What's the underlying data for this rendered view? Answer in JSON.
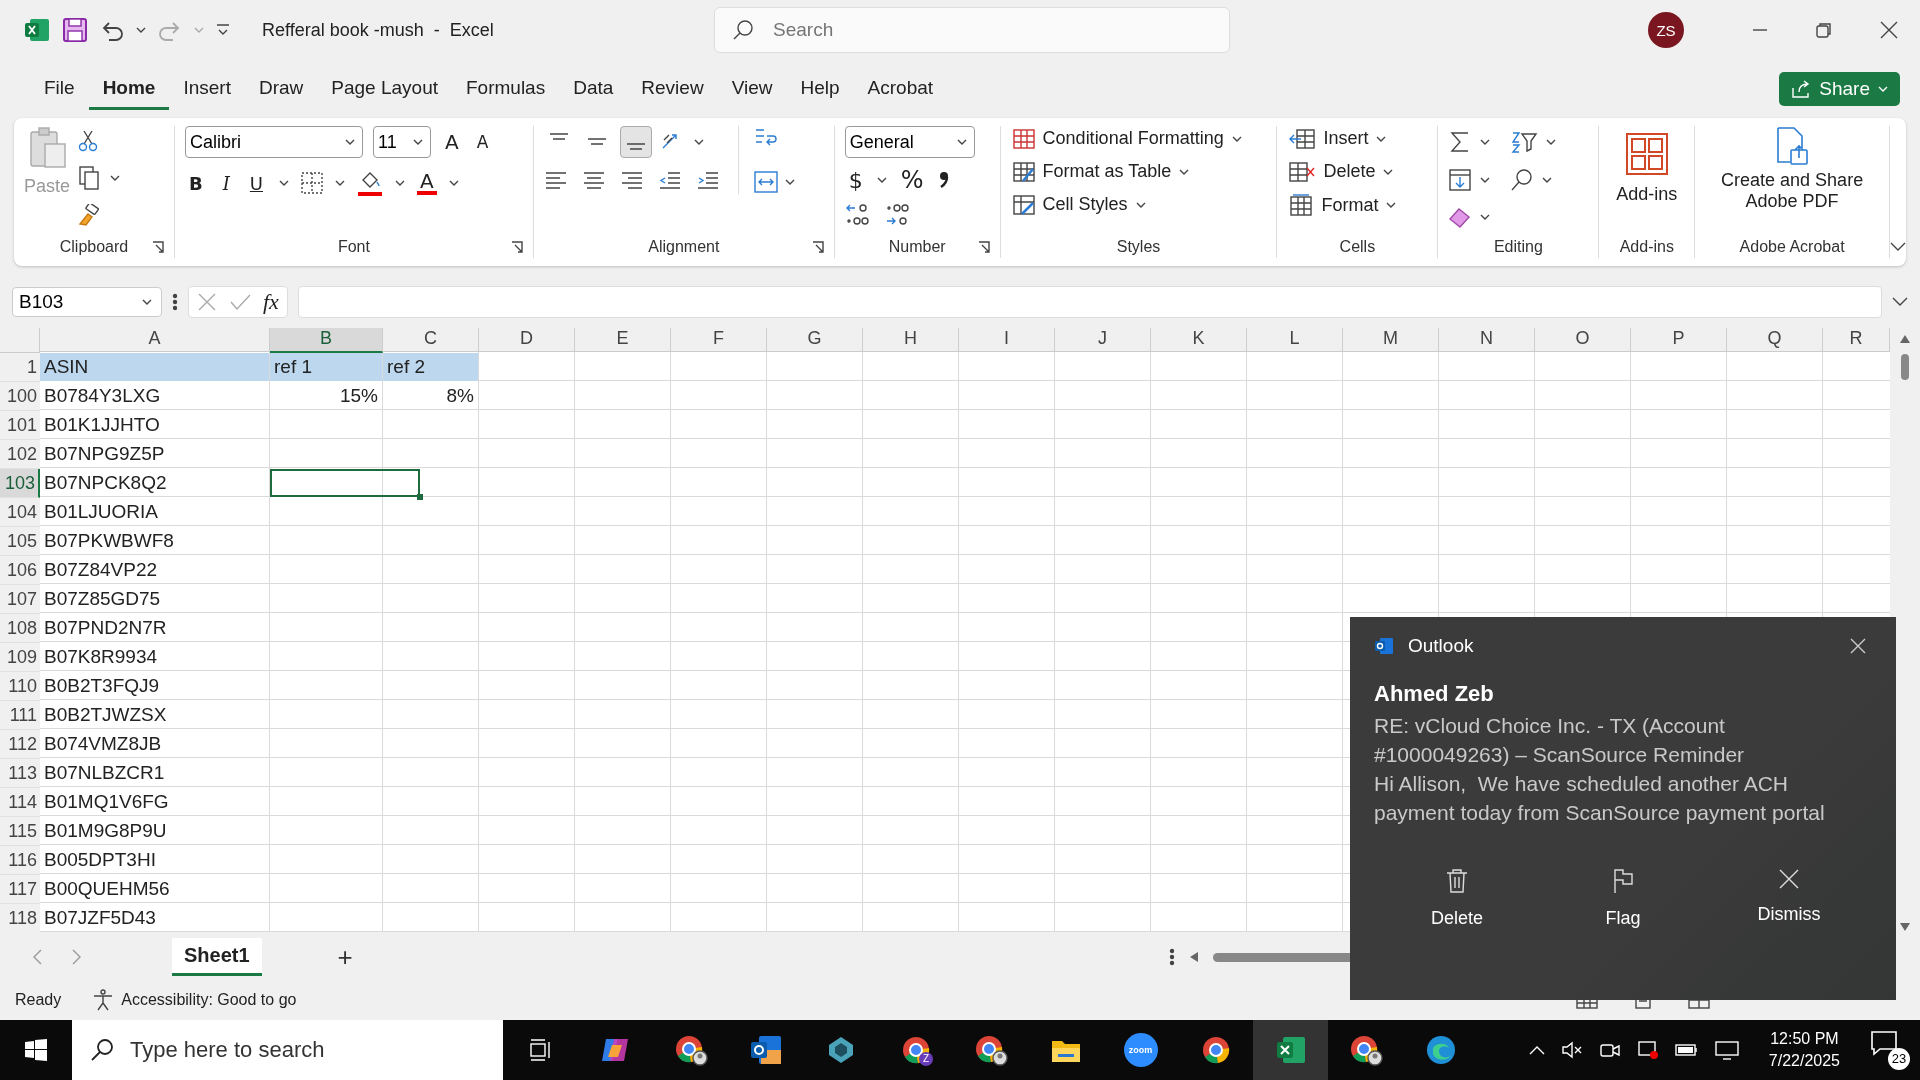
{
  "title_bar": {
    "document_title": "Refferal book -mush  -  Excel",
    "search_placeholder": "Search",
    "avatar_initials": "ZS"
  },
  "menu_tabs": [
    {
      "label": "File",
      "selected": false
    },
    {
      "label": "Home",
      "selected": true
    },
    {
      "label": "Insert",
      "selected": false
    },
    {
      "label": "Draw",
      "selected": false
    },
    {
      "label": "Page Layout",
      "selected": false
    },
    {
      "label": "Formulas",
      "selected": false
    },
    {
      "label": "Data",
      "selected": false
    },
    {
      "label": "Review",
      "selected": false
    },
    {
      "label": "View",
      "selected": false
    },
    {
      "label": "Help",
      "selected": false
    },
    {
      "label": "Acrobat",
      "selected": false
    }
  ],
  "share_button": "Share",
  "ribbon": {
    "clipboard": {
      "paste": "Paste",
      "label": "Clipboard"
    },
    "font": {
      "font_name": "Calibri",
      "font_size": "11",
      "grow": "A",
      "shrink": "A",
      "bold": "B",
      "italic": "I",
      "underline": "U",
      "font_color": "A",
      "label": "Font"
    },
    "alignment": {
      "vertical_align": [
        {
          "selected": false
        },
        {
          "selected": false
        },
        {
          "selected": true
        }
      ],
      "label": "Alignment"
    },
    "number": {
      "format": "General",
      "currency": "$",
      "percent": "%",
      "label": "Number"
    },
    "styles": {
      "items": [
        {
          "label": "Conditional Formatting",
          "kind": "conditional"
        },
        {
          "label": "Format as Table",
          "kind": "table"
        },
        {
          "label": "Cell Styles",
          "kind": "cellstyle"
        }
      ],
      "label": "Styles"
    },
    "cells": {
      "items": [
        {
          "label": "Insert",
          "kind": "insert"
        },
        {
          "label": "Delete",
          "kind": "delete"
        },
        {
          "label": "Format",
          "kind": "format"
        }
      ],
      "label": "Cells"
    },
    "editing": {
      "label": "Editing"
    },
    "addins": {
      "button": "Add-ins",
      "label": "Add-ins"
    },
    "acrobat": {
      "button": "Create and Share Adobe PDF",
      "label": "Adobe Acrobat"
    }
  },
  "formula_bar": {
    "name_box": "B103",
    "fx": "fx"
  },
  "sheet": {
    "columns": [
      {
        "letter": "A",
        "selected": false
      },
      {
        "letter": "B",
        "selected": true
      },
      {
        "letter": "C",
        "selected": false
      },
      {
        "letter": "D",
        "selected": false
      },
      {
        "letter": "E",
        "selected": false
      },
      {
        "letter": "F",
        "selected": false
      },
      {
        "letter": "G",
        "selected": false
      },
      {
        "letter": "H",
        "selected": false
      },
      {
        "letter": "I",
        "selected": false
      },
      {
        "letter": "J",
        "selected": false
      },
      {
        "letter": "K",
        "selected": false
      },
      {
        "letter": "L",
        "selected": false
      },
      {
        "letter": "M",
        "selected": false
      },
      {
        "letter": "N",
        "selected": false
      },
      {
        "letter": "O",
        "selected": false
      },
      {
        "letter": "P",
        "selected": false
      },
      {
        "letter": "Q",
        "selected": false
      },
      {
        "letter": "R",
        "selected": false
      }
    ],
    "rows": [
      {
        "number": "1",
        "kind": "header",
        "selected": false,
        "cells": [
          {
            "text": "ASIN"
          },
          {
            "text": "ref 1"
          },
          {
            "text": "ref 2"
          }
        ]
      },
      {
        "number": "100",
        "kind": "data",
        "selected": false,
        "cells": [
          {
            "text": "B0784Y3LXG"
          },
          {
            "text": "15%",
            "kind": "number"
          },
          {
            "text": "8%",
            "kind": "number"
          }
        ]
      },
      {
        "number": "101",
        "kind": "data",
        "selected": false,
        "cells": [
          {
            "text": "B01K1JJHTO"
          }
        ]
      },
      {
        "number": "102",
        "kind": "data",
        "selected": false,
        "cells": [
          {
            "text": "B07NPG9Z5P"
          }
        ]
      },
      {
        "number": "103",
        "kind": "data",
        "selected": true,
        "cells": [
          {
            "text": "B07NPCK8Q2"
          }
        ]
      },
      {
        "number": "104",
        "kind": "data",
        "selected": false,
        "cells": [
          {
            "text": "B01LJUORIA"
          }
        ]
      },
      {
        "number": "105",
        "kind": "data",
        "selected": false,
        "cells": [
          {
            "text": "B07PKWBWF8"
          }
        ]
      },
      {
        "number": "106",
        "kind": "data",
        "selected": false,
        "cells": [
          {
            "text": "B07Z84VP22"
          }
        ]
      },
      {
        "number": "107",
        "kind": "data",
        "selected": false,
        "cells": [
          {
            "text": "B07Z85GD75"
          }
        ]
      },
      {
        "number": "108",
        "kind": "data",
        "selected": false,
        "cells": [
          {
            "text": "B07PND2N7R"
          }
        ]
      },
      {
        "number": "109",
        "kind": "data",
        "selected": false,
        "cells": [
          {
            "text": "B07K8R9934"
          }
        ]
      },
      {
        "number": "110",
        "kind": "data",
        "selected": false,
        "cells": [
          {
            "text": "B0B2T3FQJ9"
          }
        ]
      },
      {
        "number": "111",
        "kind": "data",
        "selected": false,
        "cells": [
          {
            "text": "B0B2TJWZSX"
          }
        ]
      },
      {
        "number": "112",
        "kind": "data",
        "selected": false,
        "cells": [
          {
            "text": "B074VMZ8JB"
          }
        ]
      },
      {
        "number": "113",
        "kind": "data",
        "selected": false,
        "cells": [
          {
            "text": "B07NLBZCR1"
          }
        ]
      },
      {
        "number": "114",
        "kind": "data",
        "selected": false,
        "cells": [
          {
            "text": "B01MQ1V6FG"
          }
        ]
      },
      {
        "number": "115",
        "kind": "data",
        "selected": false,
        "cells": [
          {
            "text": "B01M9G8P9U"
          }
        ]
      },
      {
        "number": "116",
        "kind": "data",
        "selected": false,
        "cells": [
          {
            "text": "B005DPT3HI"
          }
        ]
      },
      {
        "number": "117",
        "kind": "data",
        "selected": false,
        "cells": [
          {
            "text": "B00QUEHM56"
          }
        ]
      },
      {
        "number": "118",
        "kind": "data",
        "selected": false,
        "cells": [
          {
            "text": "B07JZF5D43"
          }
        ]
      }
    ]
  },
  "sheet_tabs": {
    "tabs": [
      {
        "label": "Sheet1",
        "selected": true
      }
    ],
    "add": "+"
  },
  "status_bar": {
    "ready": "Ready",
    "accessibility": "Accessibility: Good to go"
  },
  "notification": {
    "app": "Outlook",
    "sender": "Ahmed Zeb",
    "subject": "RE: vCloud Choice Inc. - TX (Account #1000049263) – ScanSource Reminder",
    "body": "Hi Allison,  We have scheduled another ACH payment today from ScanSource payment portal",
    "actions": [
      {
        "label": "Delete",
        "kind": "delete"
      },
      {
        "label": "Flag",
        "kind": "flag"
      },
      {
        "label": "Dismiss",
        "kind": "dismiss"
      }
    ]
  },
  "taskbar": {
    "search_placeholder": "Type here to search",
    "apps": [
      {
        "kind": "copilot",
        "selected": false
      },
      {
        "kind": "chrome-profile",
        "selected": false
      },
      {
        "kind": "outlook",
        "selected": false
      },
      {
        "kind": "diamond",
        "selected": false
      },
      {
        "kind": "chrome-badge",
        "badge": "Z",
        "selected": false
      },
      {
        "kind": "chrome-profile",
        "selected": false
      },
      {
        "kind": "explorer",
        "selected": false
      },
      {
        "kind": "zoom",
        "label": "zoom",
        "selected": false
      },
      {
        "kind": "chrome",
        "selected": false
      },
      {
        "kind": "excel",
        "selected": true
      },
      {
        "kind": "chrome-profile",
        "selected": false
      },
      {
        "kind": "edge",
        "selected": false
      }
    ],
    "time": "12:50 PM",
    "date": "7/22/2025",
    "notification_count": "23"
  }
}
